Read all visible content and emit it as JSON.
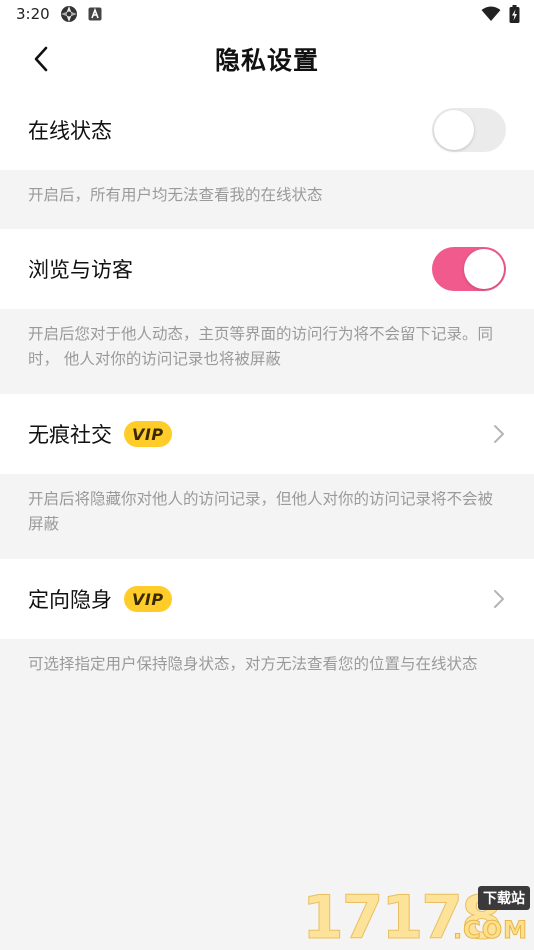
{
  "status_bar": {
    "time": "3:20",
    "icons": [
      "aperture-icon",
      "a-notification-icon",
      "wifi-icon",
      "battery-charging-icon"
    ]
  },
  "nav": {
    "title": "隐私设置",
    "back_icon": "chevron-left-icon"
  },
  "settings": [
    {
      "label": "在线状态",
      "control": "toggle",
      "enabled": false,
      "description": "开启后，所有用户均无法查看我的在线状态"
    },
    {
      "label": "浏览与访客",
      "control": "toggle",
      "enabled": true,
      "description": "开启后您对于他人动态，主页等界面的访问行为将不会留下记录。同时， 他人对你的访问记录也将被屏蔽"
    },
    {
      "label": "无痕社交",
      "badge": "VIP",
      "control": "chevron",
      "description": "开启后将隐藏你对他人的访问记录，但他人对你的访问记录将不会被屏蔽"
    },
    {
      "label": "定向隐身",
      "badge": "VIP",
      "control": "chevron",
      "description": "可选择指定用户保持隐身状态，对方无法查看您的位置与在线状态"
    }
  ],
  "colors": {
    "toggle_on": "#f05a8c",
    "toggle_off": "#ebebeb",
    "vip_badge": "#ffcc29",
    "background": "#f4f4f4",
    "description_text": "#9a9a9a"
  },
  "watermark": {
    "digits": "17178",
    "site": "下载站",
    "suffix": ".COM"
  }
}
